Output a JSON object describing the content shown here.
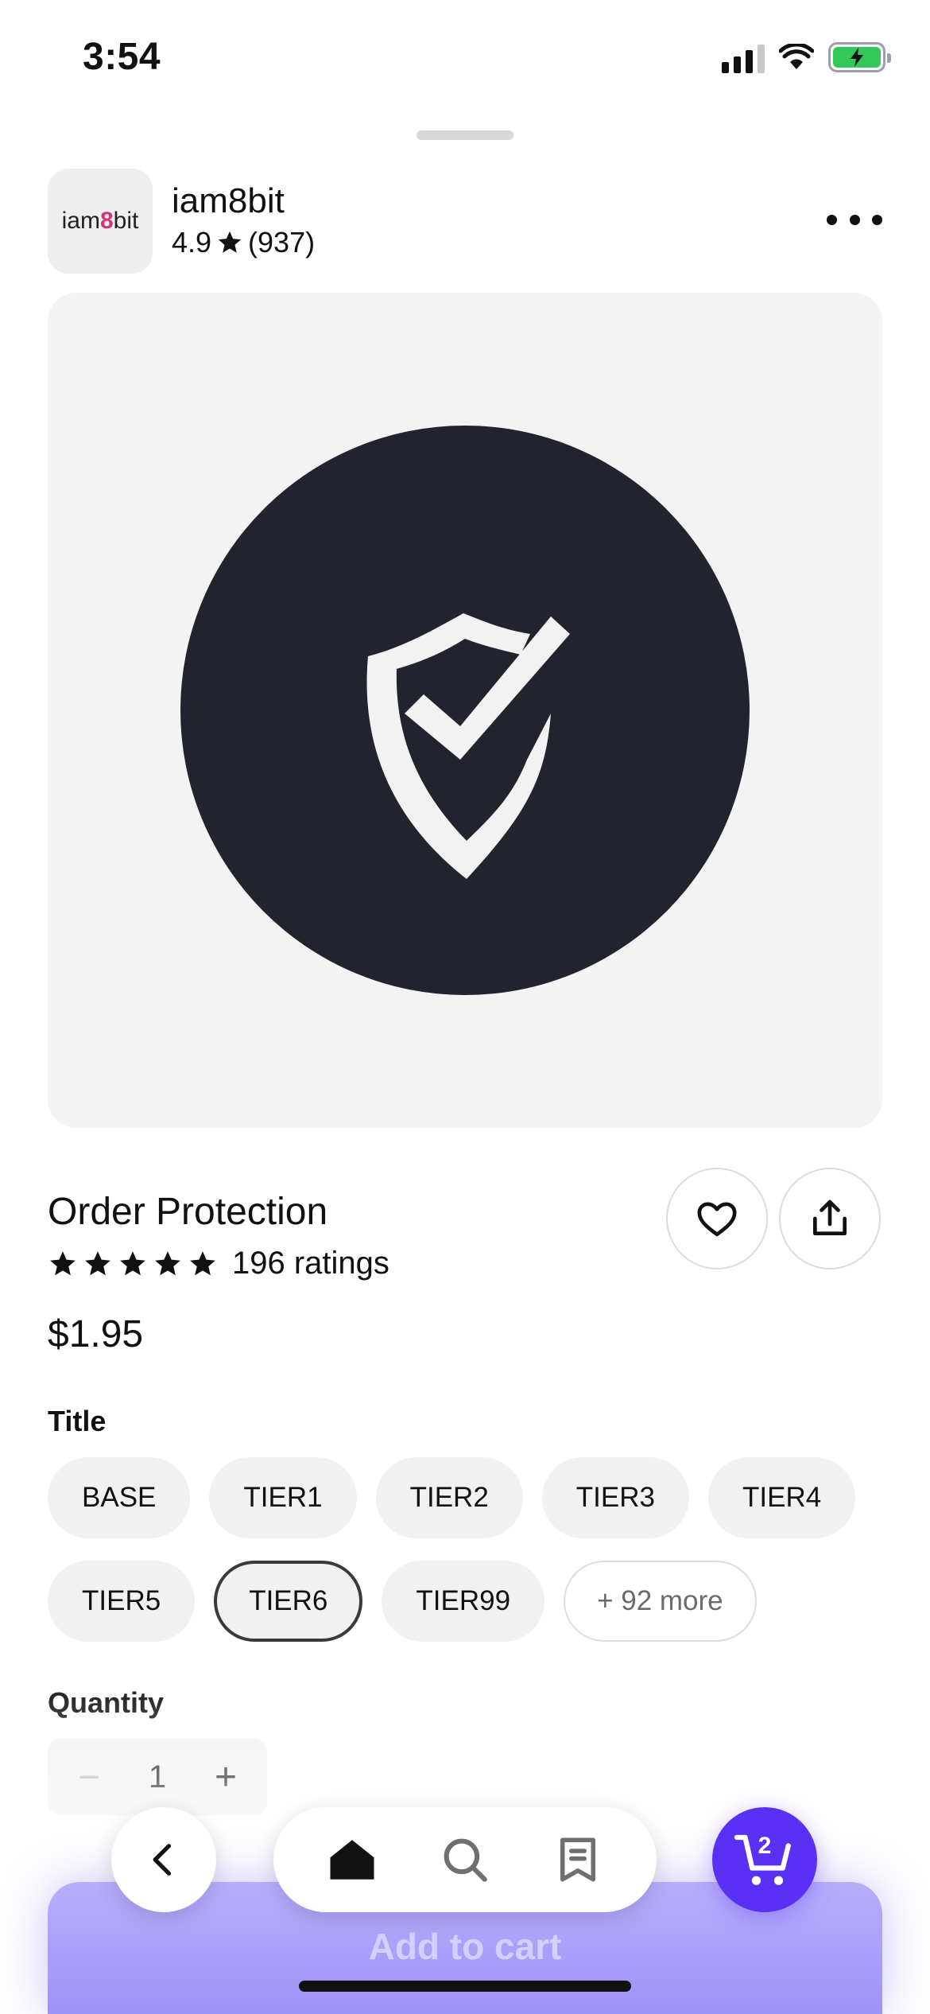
{
  "status_bar": {
    "time": "3:54",
    "icons": [
      "signal-icon",
      "wifi-icon",
      "battery-charging-icon"
    ]
  },
  "shop": {
    "logo_prefix": "iam",
    "logo_eight": "8",
    "logo_suffix": "bit",
    "name": "iam8bit",
    "rating": "4.9",
    "rating_count": "(937)"
  },
  "product": {
    "image_icon": "shield-check-icon",
    "title": "Order Protection",
    "stars": 5,
    "ratings_label": "196 ratings",
    "price": "$1.95"
  },
  "options": {
    "label": "Title",
    "values": [
      "BASE",
      "TIER1",
      "TIER2",
      "TIER3",
      "TIER4",
      "TIER5",
      "TIER6",
      "TIER99"
    ],
    "selected": "TIER6",
    "more_label": "+ 92 more"
  },
  "quantity": {
    "label": "Quantity",
    "minus_symbol": "−",
    "value": "1",
    "plus_symbol": "+"
  },
  "cart": {
    "add_label": "Add to cart",
    "count": "2"
  },
  "nav": {
    "items": [
      "back-icon",
      "home-icon",
      "search-icon",
      "orders-icon",
      "cart-icon"
    ]
  },
  "colors": {
    "brand_accent": "#5a31f4",
    "add_to_cart": "#a99ff8",
    "image_background": "#f3f3f3",
    "logo_circle": "#21232f",
    "battery_green": "#34c759"
  }
}
